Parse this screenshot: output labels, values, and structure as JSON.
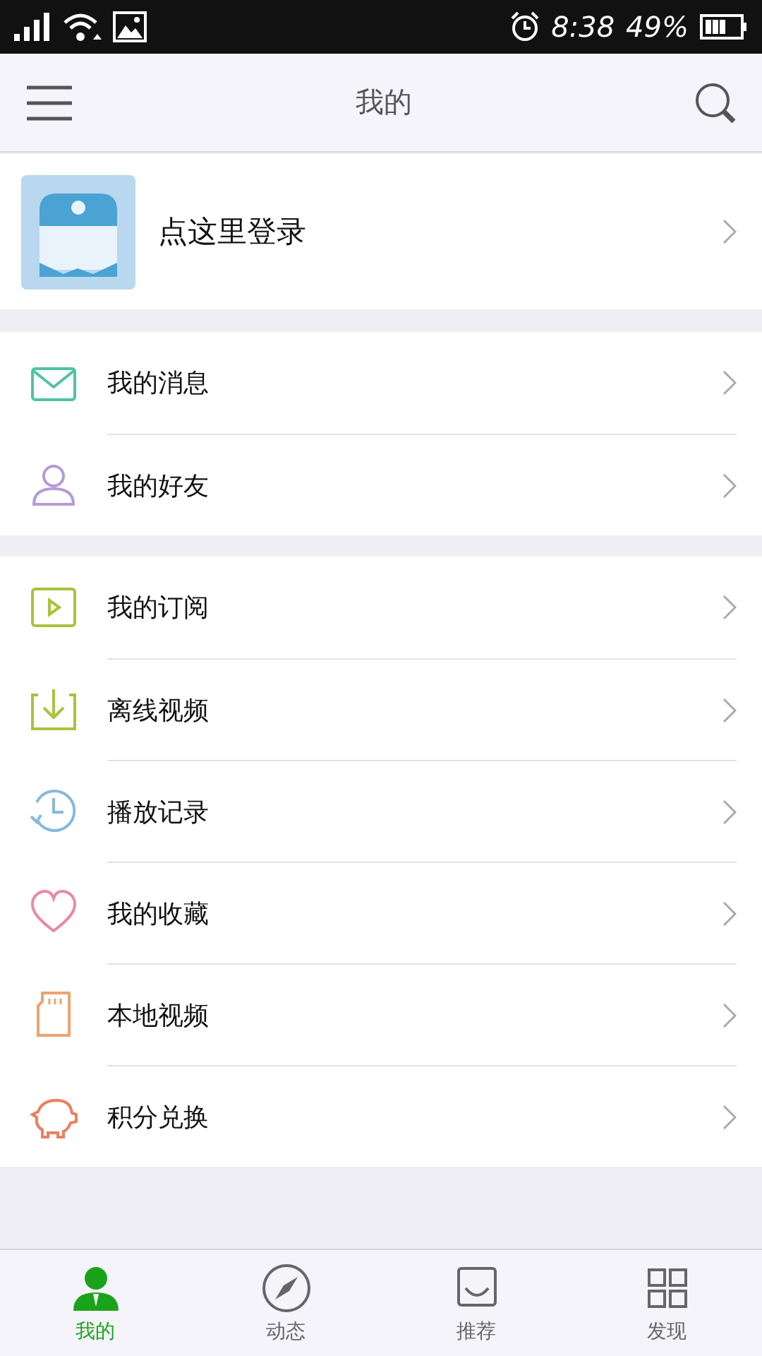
{
  "status_bar": {
    "time": "8:38",
    "battery": "49%"
  },
  "header": {
    "title": "我的"
  },
  "profile": {
    "label": "点这里登录"
  },
  "menu_groups": [
    {
      "items": [
        {
          "label": "我的消息"
        },
        {
          "label": "我的好友"
        }
      ]
    },
    {
      "items": [
        {
          "label": "我的订阅"
        },
        {
          "label": "离线视频"
        },
        {
          "label": "播放记录"
        },
        {
          "label": "我的收藏"
        },
        {
          "label": "本地视频"
        },
        {
          "label": "积分兑换"
        }
      ]
    }
  ],
  "bottom_tabs": [
    {
      "label": "我的",
      "selected": true
    },
    {
      "label": "动态",
      "selected": false
    },
    {
      "label": "推荐",
      "selected": false
    },
    {
      "label": "发现",
      "selected": false
    }
  ]
}
